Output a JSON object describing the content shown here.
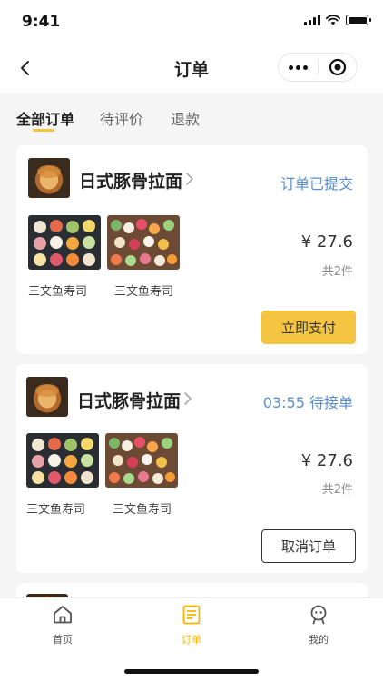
{
  "status_bar": {
    "time": "9:41"
  },
  "nav": {
    "title": "订单"
  },
  "tabs": [
    {
      "label": "全部订单",
      "active": true
    },
    {
      "label": "待评价",
      "active": false
    },
    {
      "label": "退款",
      "active": false
    }
  ],
  "orders": [
    {
      "shop_name": "日式豚骨拉面",
      "status": "订单已提交",
      "items": [
        {
          "name": "三文鱼寿司"
        },
        {
          "name": "三文鱼寿司"
        }
      ],
      "price": "¥ 27.6",
      "count": "共2件",
      "action_label": "立即支付"
    },
    {
      "shop_name": "日式豚骨拉面",
      "status": "03:55 待接单",
      "items": [
        {
          "name": "三文鱼寿司"
        },
        {
          "name": "三文鱼寿司"
        }
      ],
      "price": "¥ 27.6",
      "count": "共2件",
      "action_label": "取消订单"
    }
  ],
  "tabbar": [
    {
      "label": "首页",
      "icon": "home-icon",
      "active": false
    },
    {
      "label": "订单",
      "icon": "order-icon",
      "active": true
    },
    {
      "label": "我的",
      "icon": "profile-icon",
      "active": false
    }
  ],
  "colors": {
    "accent": "#f5c542",
    "status_blue": "#5a8fd6",
    "active_tab": "#f5b500"
  }
}
